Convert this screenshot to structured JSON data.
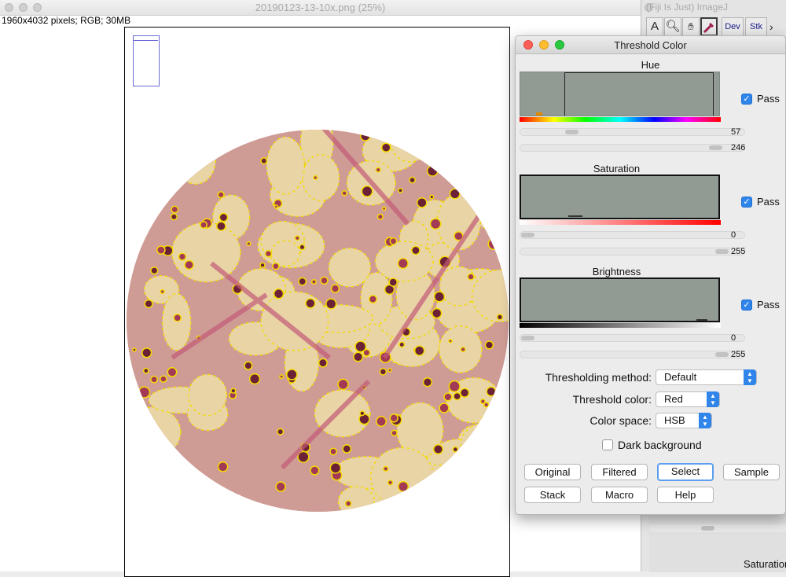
{
  "image_window": {
    "title": "20190123-13-10x.png (25%)",
    "info": "1960x4032 pixels; RGB; 30MB"
  },
  "imagej_window": {
    "title": "(Fiji Is Just) ImageJ",
    "tools": [
      "A",
      "Dev",
      "Stk"
    ],
    "icons": [
      "text-tool-icon",
      "magnifier-icon",
      "hand-icon",
      "color-picker-icon",
      "chevron-right-icon"
    ],
    "bottom_label": "Saturation"
  },
  "threshold_dialog": {
    "title": "Threshold Color",
    "sections": [
      {
        "title": "Hue",
        "pass_label": "Pass",
        "pass": true,
        "min": "57",
        "max": "246"
      },
      {
        "title": "Saturation",
        "pass_label": "Pass",
        "pass": true,
        "min": "0",
        "max": "255"
      },
      {
        "title": "Brightness",
        "pass_label": "Pass",
        "pass": true,
        "min": "0",
        "max": "255"
      }
    ],
    "thresholding_method_label": "Thresholding method:",
    "thresholding_method": "Default",
    "threshold_color_label": "Threshold color:",
    "threshold_color": "Red",
    "color_space_label": "Color space:",
    "color_space": "HSB",
    "dark_background_label": "Dark background",
    "dark_background": false,
    "buttons_row1": [
      "Original",
      "Filtered",
      "Select",
      "Sample"
    ],
    "buttons_row2": [
      "Stack",
      "Macro",
      "Help"
    ],
    "focused_button": "Select"
  },
  "colors": {
    "histogram": "#919b94",
    "checkbox": "#2f85ea",
    "tissue": "#e9d4a6",
    "stain": "#c9607c",
    "threshold": "#f2dc00"
  }
}
